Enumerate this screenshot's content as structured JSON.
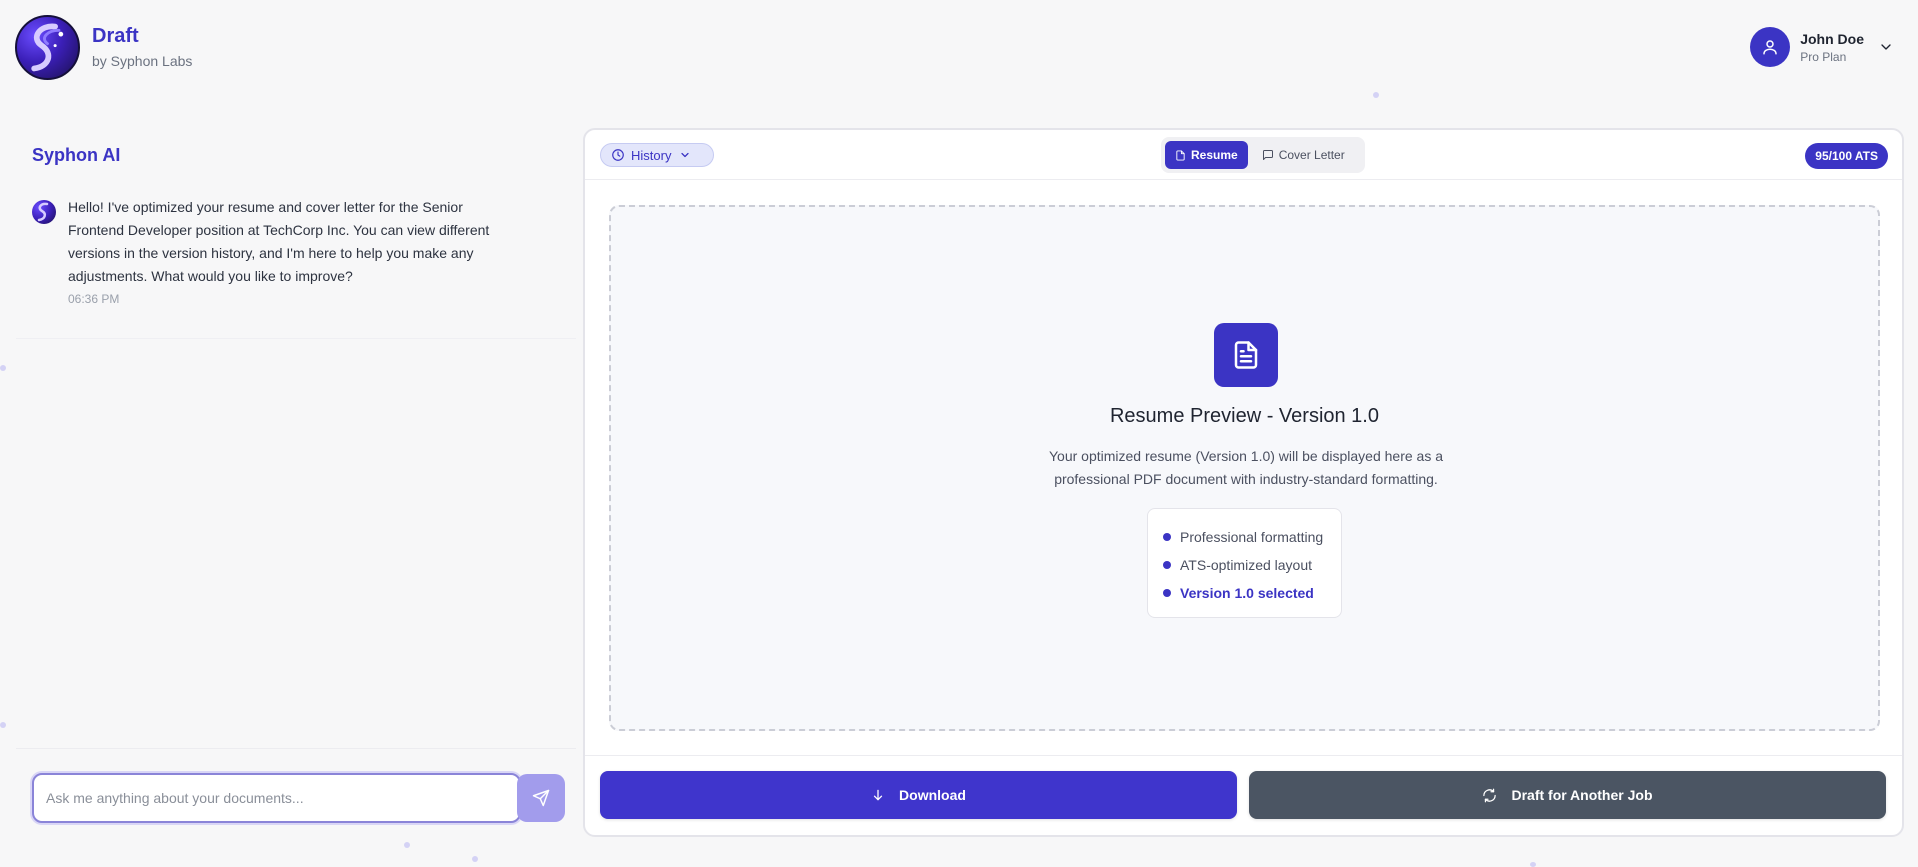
{
  "header": {
    "brand_title": "Draft",
    "brand_subtitle": "by Syphon Labs",
    "user_name": "John Doe",
    "user_plan": "Pro Plan"
  },
  "chat": {
    "title": "Syphon AI",
    "message_text": "Hello! I've optimized your resume and cover letter for the Senior Frontend Developer position at TechCorp Inc. You can view different versions in the version history, and I'm here to help you make any adjustments. What would you like to improve?",
    "message_time": "06:36 PM",
    "input_placeholder": "Ask me anything about your documents...",
    "input_value": ""
  },
  "document": {
    "history_label": "History",
    "tabs": [
      {
        "label": "Resume",
        "active": true
      },
      {
        "label": "Cover Letter",
        "active": false
      }
    ],
    "ats_badge": "95/100 ATS",
    "preview_title": "Resume Preview - Version 1.0",
    "preview_description": "Your optimized resume (Version 1.0) will be displayed here as a professional PDF document with industry-standard formatting.",
    "features": [
      {
        "label": "Professional formatting"
      },
      {
        "label": "ATS-optimized layout"
      },
      {
        "label": "Version 1.0 selected"
      }
    ],
    "download_label": "Download",
    "another_job_label": "Draft for Another Job"
  },
  "colors": {
    "accent": "#3b34c4",
    "secondary_button": "#4b5563",
    "background": "#f7f7f8"
  },
  "icons": {
    "history": "clock-icon",
    "resume_tab": "document-icon",
    "cover_letter_tab": "message-square-icon",
    "preview": "file-text-icon",
    "download": "arrow-down-icon",
    "another_job": "refresh-icon",
    "send": "send-icon",
    "user": "user-icon",
    "user_menu": "chevron-down-icon"
  }
}
